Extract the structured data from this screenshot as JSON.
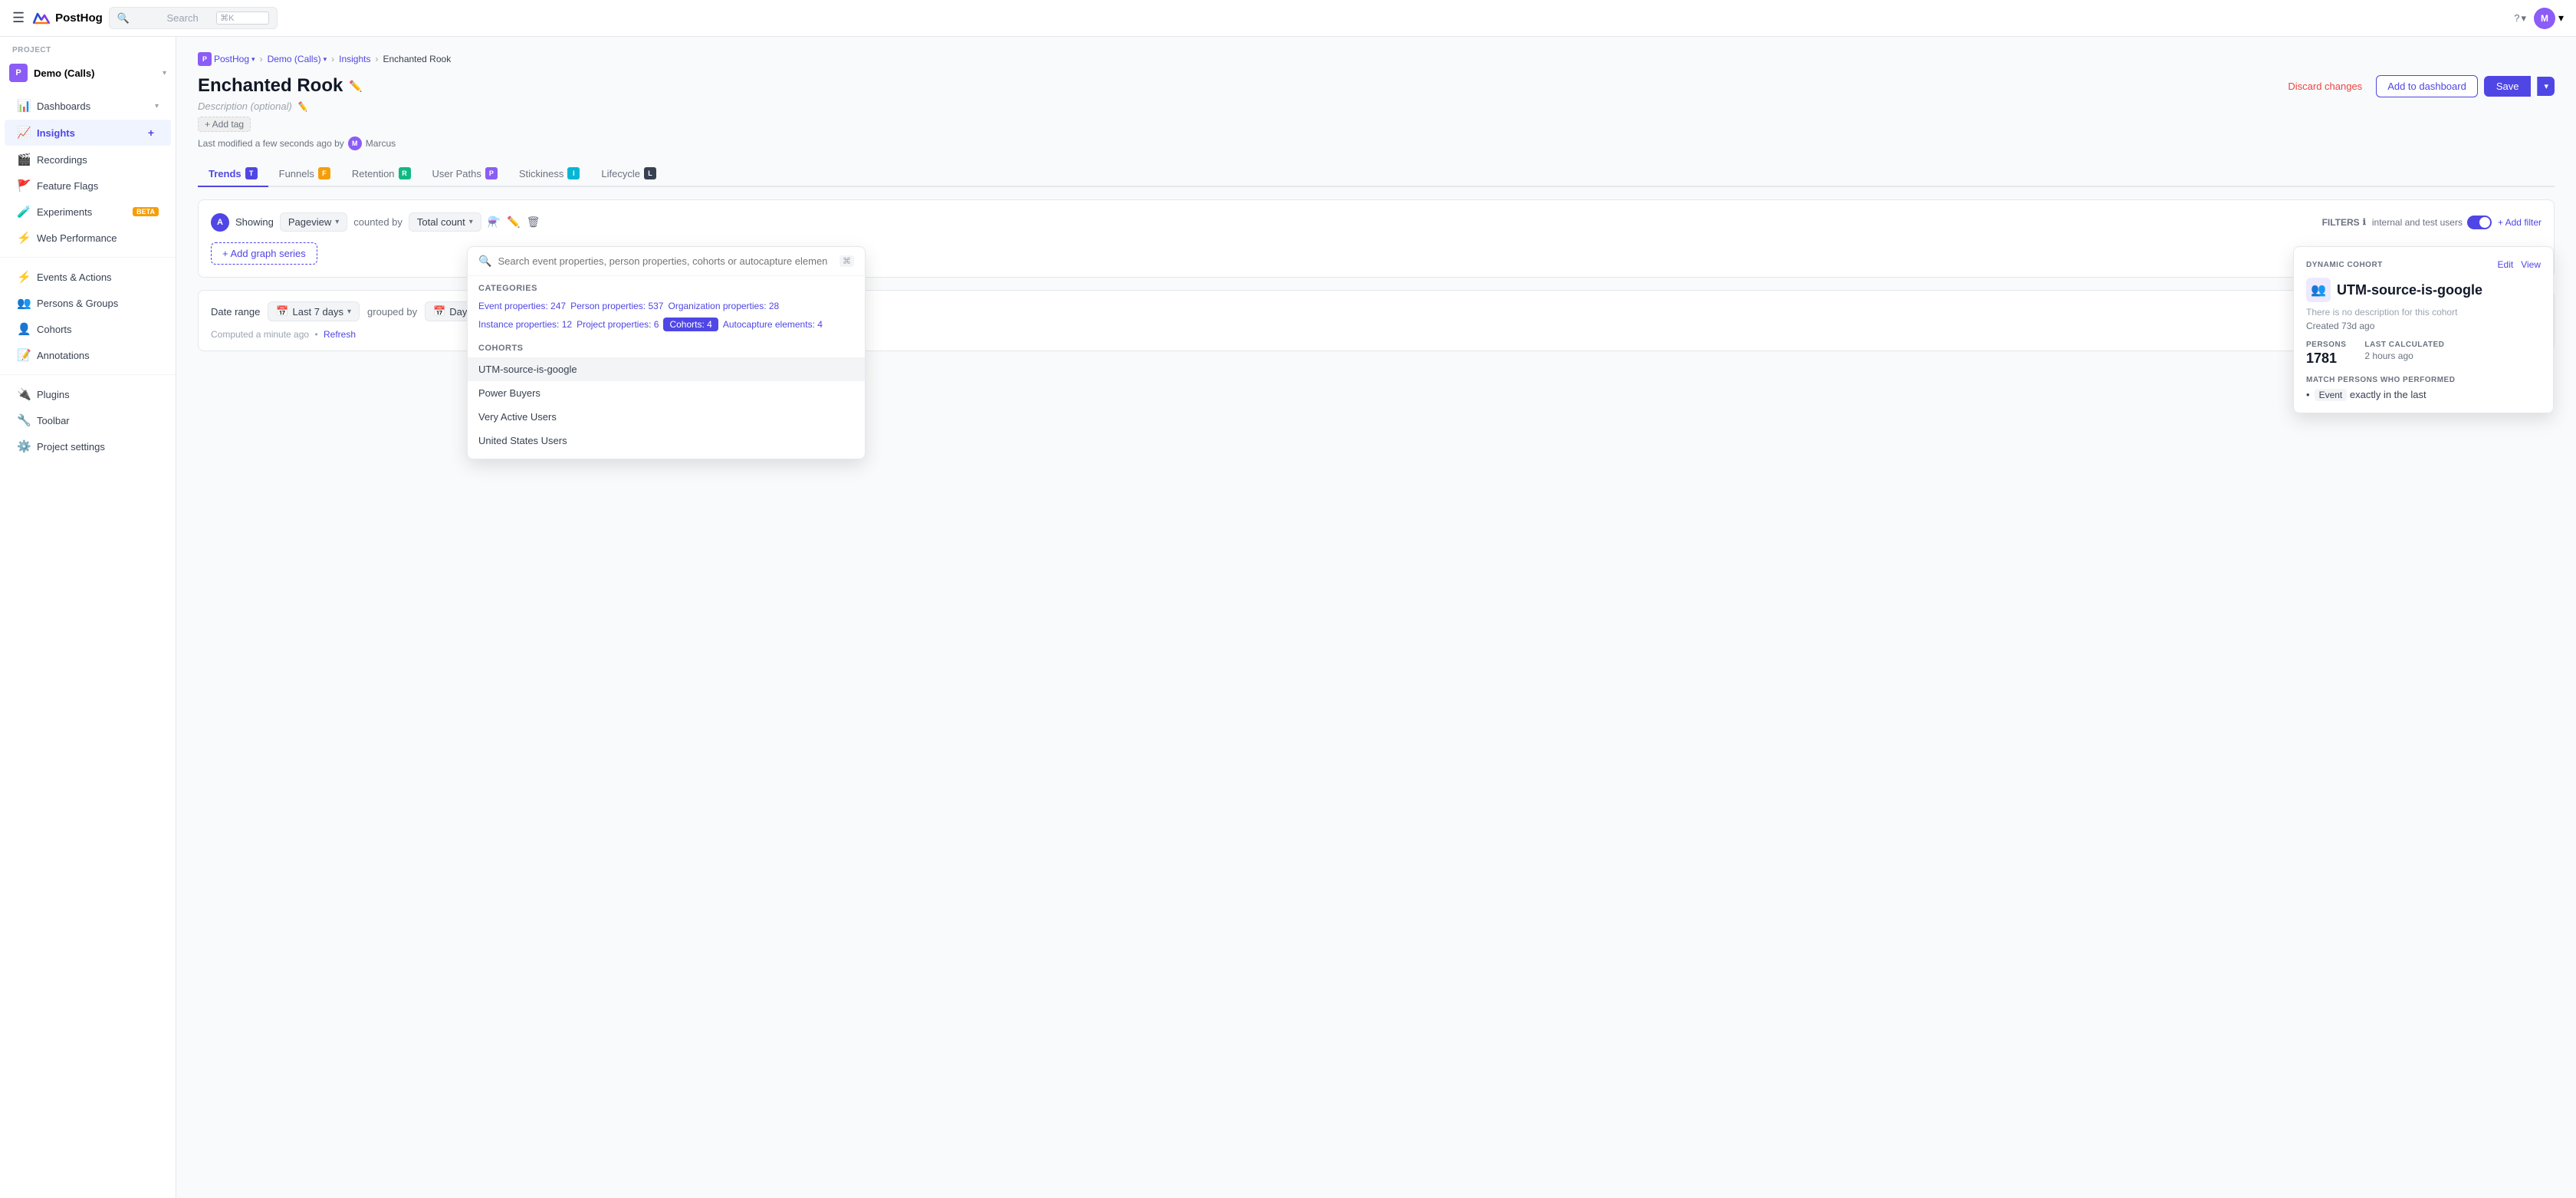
{
  "topnav": {
    "menu_icon": "☰",
    "logo_text": "PostHog",
    "search_placeholder": "Search",
    "search_shortcut": "⌘K",
    "help_label": "?",
    "avatar_initials": "M",
    "avatar_chevron": "▾"
  },
  "sidebar": {
    "project_label": "PROJECT",
    "project_name": "Demo (Calls)",
    "project_initial": "P",
    "items": [
      {
        "id": "dashboards",
        "label": "Dashboards",
        "icon": "📊",
        "has_chevron": true
      },
      {
        "id": "insights",
        "label": "Insights",
        "icon": "📈",
        "active": true,
        "has_add": true
      },
      {
        "id": "recordings",
        "label": "Recordings",
        "icon": "🎬"
      },
      {
        "id": "feature-flags",
        "label": "Feature Flags",
        "icon": "🚩"
      },
      {
        "id": "experiments",
        "label": "Experiments",
        "icon": "🧪",
        "badge": "BETA"
      },
      {
        "id": "web-performance",
        "label": "Web Performance",
        "icon": "⚡"
      },
      {
        "id": "events-actions",
        "label": "Events & Actions",
        "icon": "⚡"
      },
      {
        "id": "persons-groups",
        "label": "Persons & Groups",
        "icon": "👥"
      },
      {
        "id": "cohorts",
        "label": "Cohorts",
        "icon": "👤"
      },
      {
        "id": "annotations",
        "label": "Annotations",
        "icon": "📝"
      },
      {
        "id": "plugins",
        "label": "Plugins",
        "icon": "🔌"
      },
      {
        "id": "toolbar",
        "label": "Toolbar",
        "icon": "🔧"
      },
      {
        "id": "project-settings",
        "label": "Project settings",
        "icon": "⚙️"
      }
    ]
  },
  "breadcrumb": {
    "items": [
      {
        "label": "PostHog",
        "link": true
      },
      {
        "label": "Demo (Calls)",
        "link": true
      },
      {
        "label": "Insights",
        "link": true
      },
      {
        "label": "Enchanted Rook",
        "link": false
      }
    ]
  },
  "page": {
    "title": "Enchanted Rook",
    "description_placeholder": "Description (optional)",
    "add_tag_label": "+ Add tag",
    "modified_text": "Last modified a few seconds ago by",
    "modified_user": "Marcus",
    "discard_label": "Discard changes",
    "add_dashboard_label": "Add to dashboard",
    "save_label": "Save"
  },
  "tabs": [
    {
      "id": "trends",
      "label": "Trends",
      "badge": "T",
      "active": true
    },
    {
      "id": "funnels",
      "label": "Funnels",
      "badge": "F"
    },
    {
      "id": "retention",
      "label": "Retention",
      "badge": "R"
    },
    {
      "id": "user-paths",
      "label": "User Paths",
      "badge": "P"
    },
    {
      "id": "stickiness",
      "label": "Stickiness",
      "badge": "I"
    },
    {
      "id": "lifecycle",
      "label": "Lifecycle",
      "badge": "L"
    }
  ],
  "insight_controls": {
    "showing_series_label": "A",
    "showing_label": "Showing",
    "pageview_label": "Pageview",
    "counted_by_label": "counted by",
    "total_count_label": "Total count",
    "filters_label": "FILTERS",
    "add_filter_label": "+ Add filter",
    "add_series_label": "+ Add graph series",
    "internal_test_label": "internal and test users"
  },
  "filter_popup": {
    "search_placeholder": "Search event properties, person properties, cohorts or autocapture elemen",
    "categories_label": "CATEGORIES",
    "categories": [
      {
        "label": "Event properties: 247",
        "active": false
      },
      {
        "label": "Person properties: 537",
        "active": false
      },
      {
        "label": "Organization properties: 28",
        "active": false
      },
      {
        "label": "Instance properties: 12",
        "active": false
      },
      {
        "label": "Project properties: 6",
        "active": false
      },
      {
        "label": "Cohorts: 4",
        "active": true
      },
      {
        "label": "Autocapture elements: 4",
        "active": false
      }
    ],
    "cohorts_label": "COHORTS",
    "cohorts": [
      {
        "label": "UTM-source-is-google",
        "selected": true
      },
      {
        "label": "Power Buyers",
        "selected": false
      },
      {
        "label": "Very Active Users",
        "selected": false
      },
      {
        "label": "United States Users",
        "selected": false
      }
    ]
  },
  "cohort_preview": {
    "type_label": "DYNAMIC COHORT",
    "edit_label": "Edit",
    "view_label": "View",
    "icon": "👥",
    "title": "UTM-source-is-google",
    "description": "There is no description for this cohort",
    "created_label": "Created 73d ago",
    "persons_label": "PERSONS",
    "persons_value": "1781",
    "last_calculated_label": "LAST CALCULATED",
    "last_calculated_value": "2 hours ago",
    "match_label": "MATCH PERSONS WHO PERFORMED",
    "match_item": "Event  exactly in the last"
  },
  "bottom_bar": {
    "date_range_label": "Date range",
    "date_range_icon": "📅",
    "date_range_value": "Last 7 days",
    "grouped_by_label": "grouped by",
    "grouped_by_icon": "📅",
    "grouped_by_value": "Day",
    "computed_text": "Computed a minute ago",
    "refresh_label": "Refresh"
  }
}
